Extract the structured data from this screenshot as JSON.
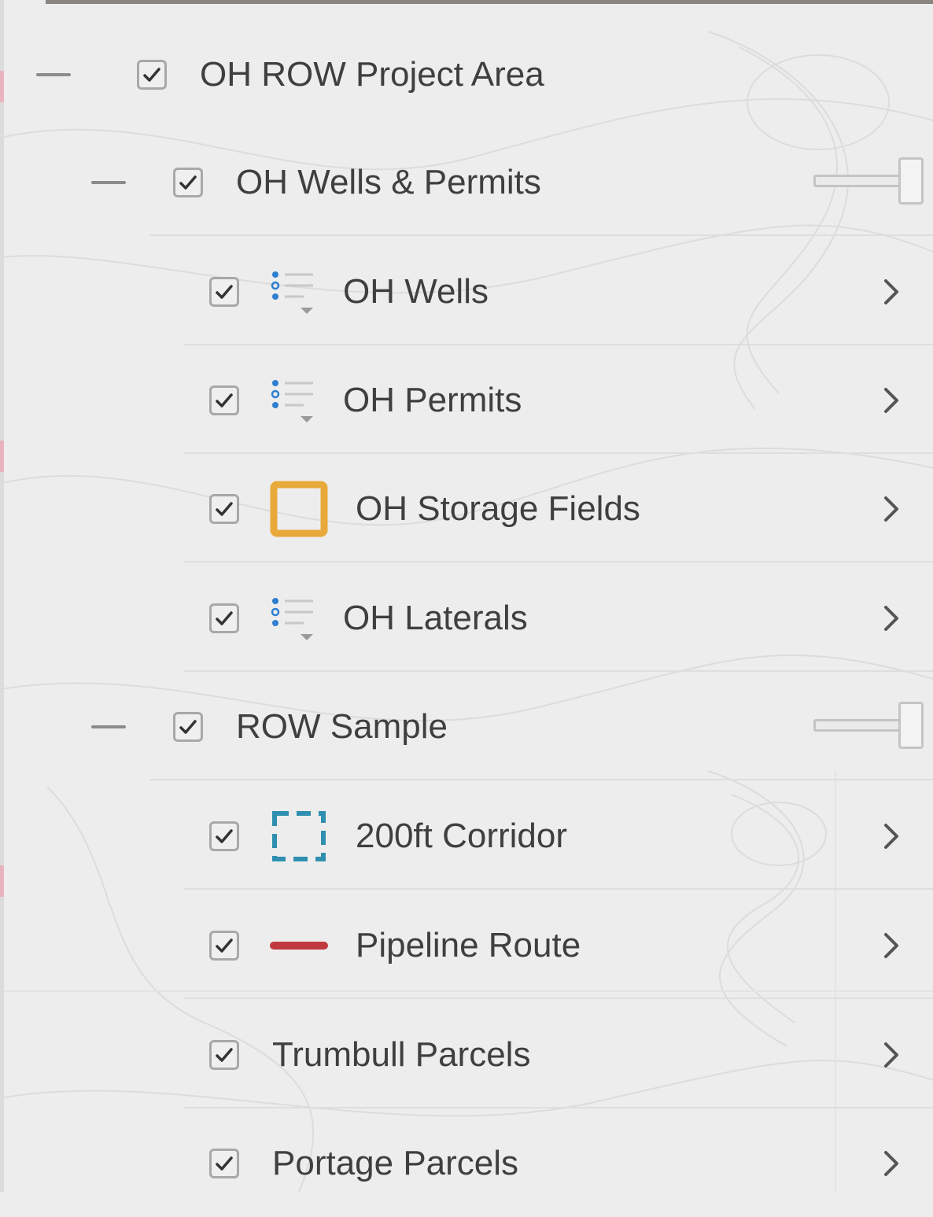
{
  "layer_list": {
    "groups": [
      {
        "label": "OH ROW Project Area",
        "checked": true,
        "expanded": true
      },
      {
        "label": "OH Wells & Permits",
        "checked": true,
        "expanded": true,
        "opacity_slider_value": 1.0,
        "layers": [
          {
            "label": "OH Wells",
            "checked": true,
            "symbol": "legend-list-icon"
          },
          {
            "label": "OH Permits",
            "checked": true,
            "symbol": "legend-list-icon"
          },
          {
            "label": "OH Storage Fields",
            "checked": true,
            "symbol": "polygon-outline-icon",
            "symbol_color": "#e8a93a"
          },
          {
            "label": "OH Laterals",
            "checked": true,
            "symbol": "legend-list-icon"
          }
        ]
      },
      {
        "label": "ROW Sample",
        "checked": true,
        "expanded": true,
        "opacity_slider_value": 1.0,
        "layers": [
          {
            "label": "200ft Corridor",
            "checked": true,
            "symbol": "dashed-polygon-icon",
            "symbol_color": "#2f8fb0"
          },
          {
            "label": "Pipeline Route",
            "checked": true,
            "symbol": "line-icon",
            "symbol_color": "#c0393f"
          },
          {
            "label": "Trumbull Parcels",
            "checked": true,
            "symbol": ""
          },
          {
            "label": "Portage Parcels",
            "checked": true,
            "symbol": ""
          }
        ]
      }
    ]
  },
  "colors": {
    "background": "#ededed",
    "text": "#3f3f3f",
    "checkbox_border": "#a8a8a8",
    "legend_blue": "#2f7fd0"
  }
}
